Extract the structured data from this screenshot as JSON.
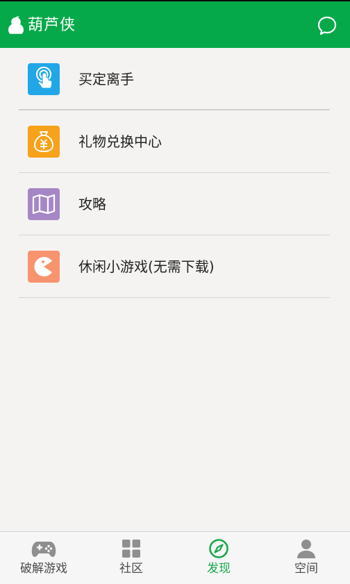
{
  "header": {
    "title": "葫芦侠",
    "logo_icon": "gourd-logo-icon",
    "chat_icon": "chat-bubble-icon"
  },
  "menu": {
    "items": [
      {
        "label": "买定离手",
        "icon": "touch-finger-icon",
        "color": "#21a7e8"
      },
      {
        "label": "礼物兑换中心",
        "icon": "money-bag-icon",
        "color": "#f6a21a"
      },
      {
        "label": "攻略",
        "icon": "map-icon",
        "color": "#a687c6"
      },
      {
        "label": "休闲小游戏(无需下载)",
        "icon": "pacman-icon",
        "color": "#f7946f"
      }
    ]
  },
  "tabs": [
    {
      "label": "破解游戏",
      "icon": "gamepad-icon",
      "active": false
    },
    {
      "label": "社区",
      "icon": "grid-icon",
      "active": false
    },
    {
      "label": "发现",
      "icon": "compass-icon",
      "active": true
    },
    {
      "label": "空间",
      "icon": "person-icon",
      "active": false
    }
  ],
  "colors": {
    "brand_green": "#06a94a",
    "active_tab": "#19a84a",
    "inactive_tab": "#8f8f8f",
    "background": "#f4f3f1"
  }
}
